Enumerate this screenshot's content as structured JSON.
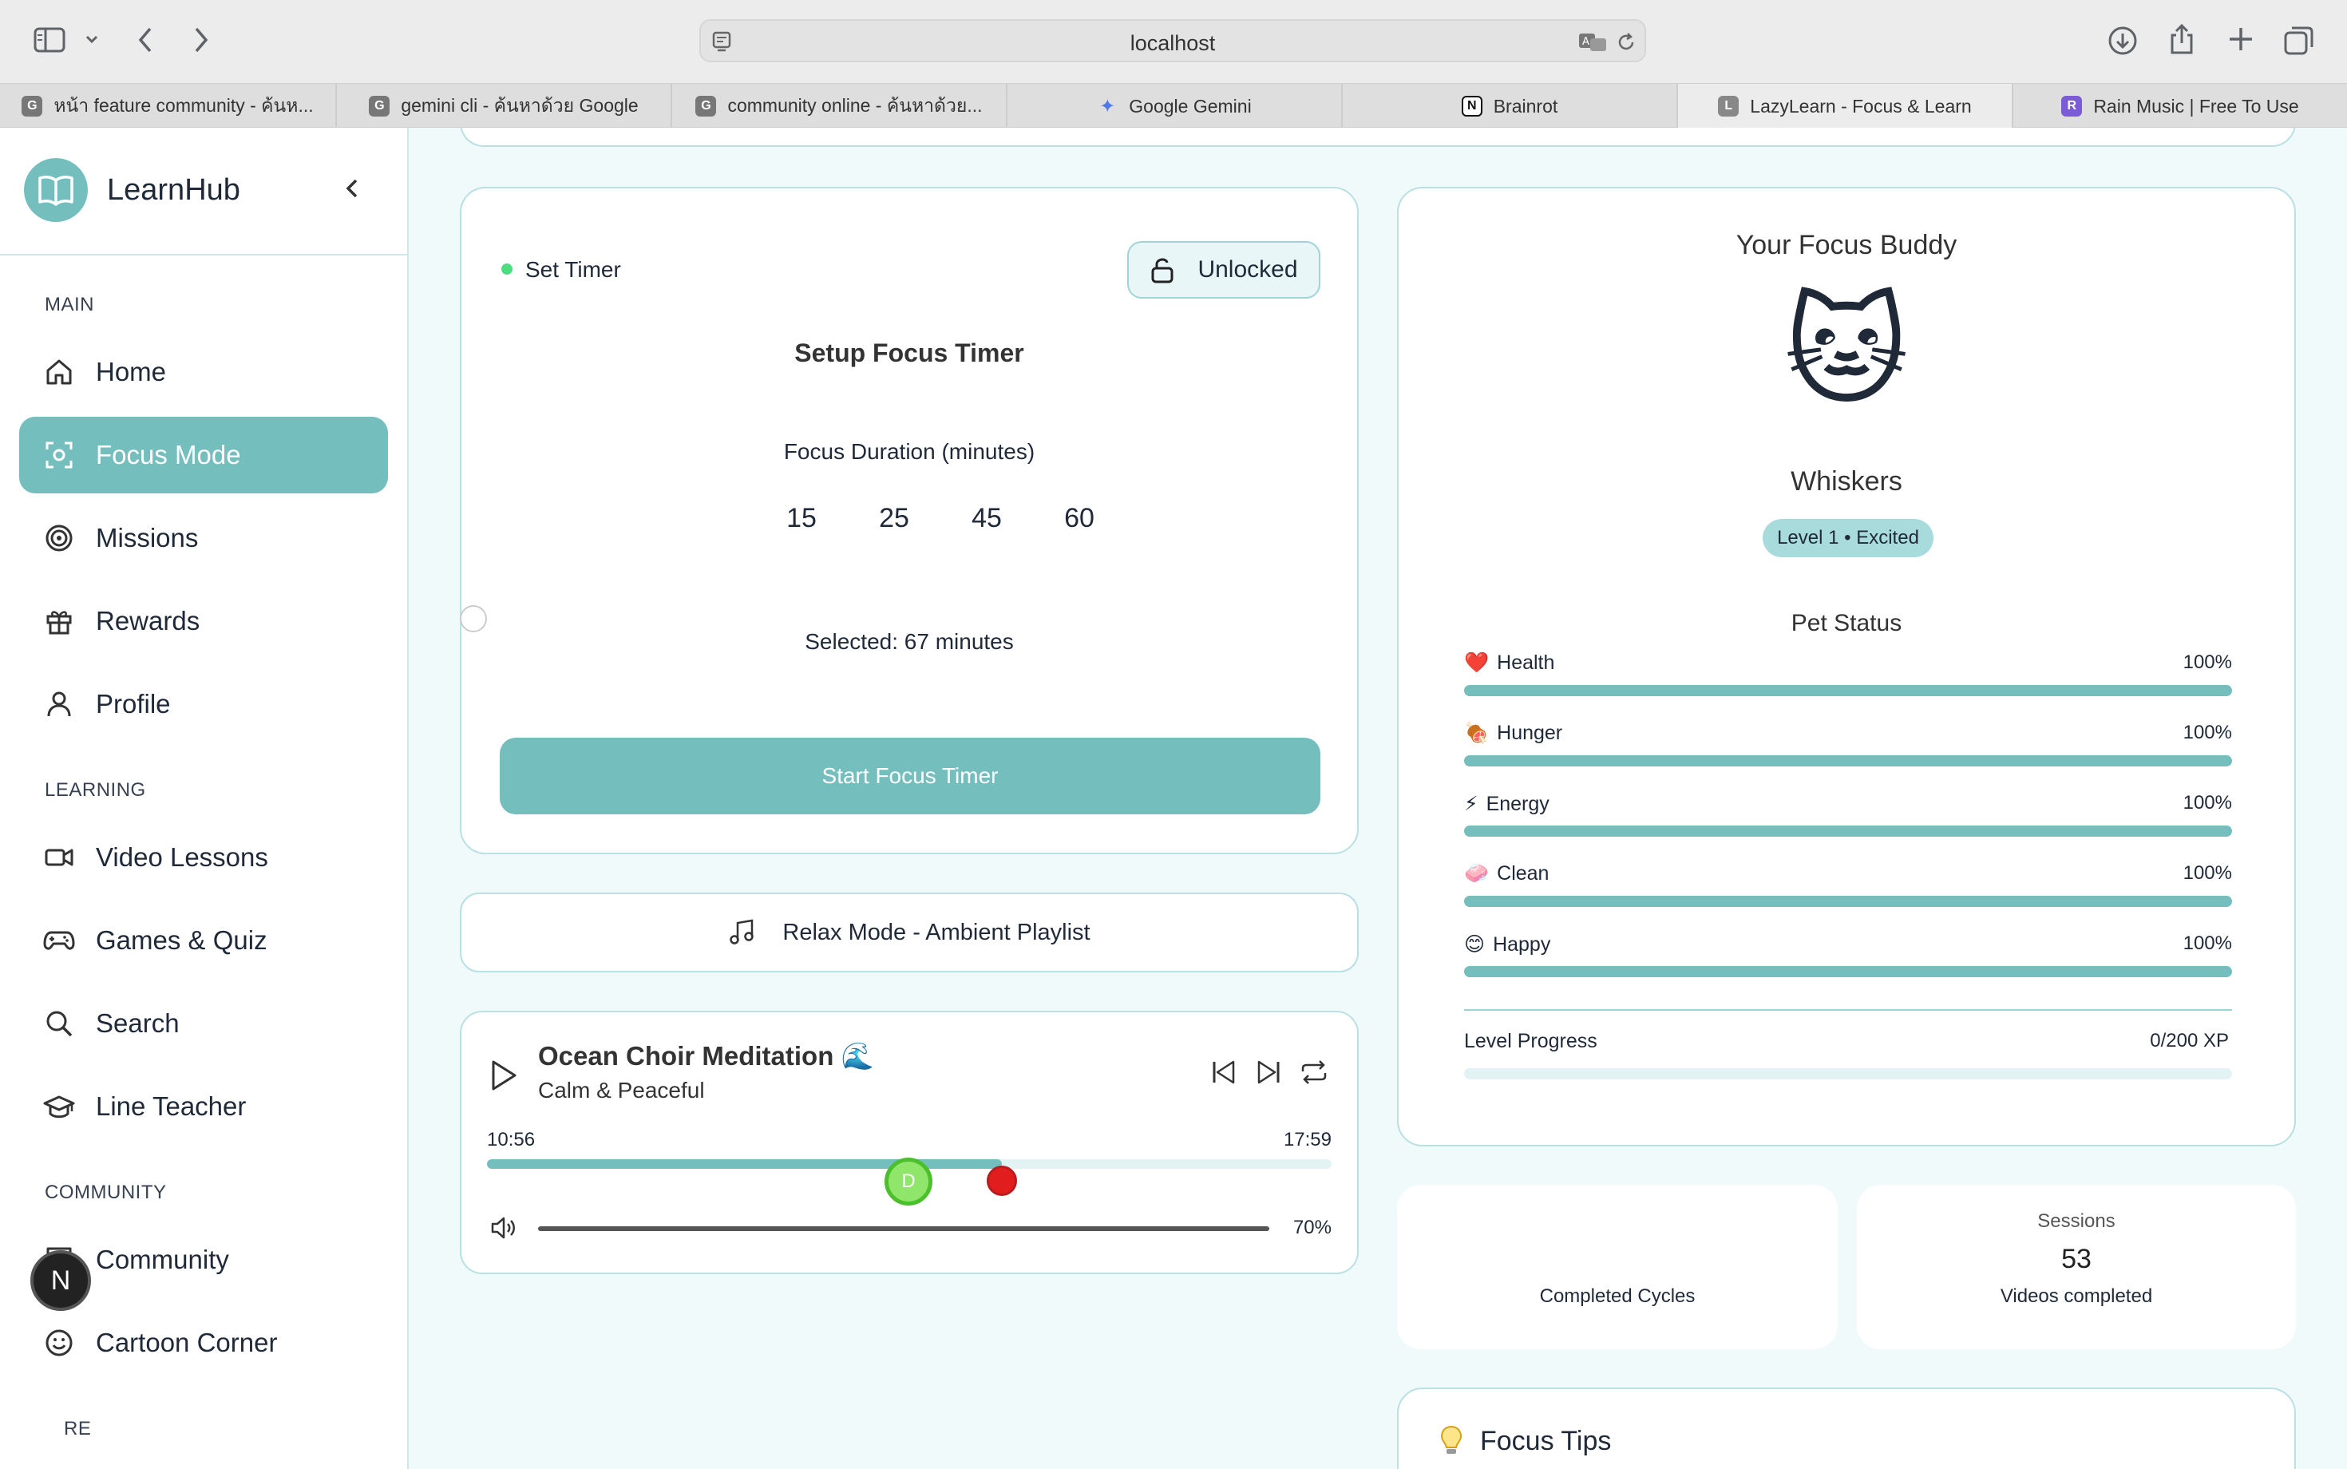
{
  "browser": {
    "url": "localhost",
    "tabs": [
      {
        "label": "หน้า feature community - ค้นห...",
        "favicon": "G"
      },
      {
        "label": "gemini cli - ค้นหาด้วย Google",
        "favicon": "G"
      },
      {
        "label": "community online - ค้นหาด้วย...",
        "favicon": "G"
      },
      {
        "label": "Google Gemini",
        "favicon": "✦"
      },
      {
        "label": "Brainrot",
        "favicon": "N"
      },
      {
        "label": "LazyLearn - Focus & Learn",
        "favicon": "L"
      },
      {
        "label": "Rain Music | Free To Use",
        "favicon": "R"
      }
    ]
  },
  "sidebar": {
    "brand": "LearnHub",
    "sections": {
      "main": "MAIN",
      "learning": "LEARNING",
      "community": "COMMUNITY",
      "more_partial": "RE"
    },
    "items": {
      "home": "Home",
      "focus": "Focus Mode",
      "missions": "Missions",
      "rewards": "Rewards",
      "profile": "Profile",
      "video": "Video Lessons",
      "games": "Games & Quiz",
      "search": "Search",
      "line_teacher": "Line Teacher",
      "community": "Community",
      "cartoon": "Cartoon Corner"
    },
    "floating_badge": "N"
  },
  "timer": {
    "status": "Set Timer",
    "lock_label": "Unlocked",
    "title": "Setup Focus Timer",
    "duration_label": "Focus Duration (minutes)",
    "durations": [
      "15",
      "25",
      "45",
      "60"
    ],
    "selected": "Selected: 67 minutes",
    "start_label": "Start Focus Timer"
  },
  "relax": {
    "label": "Relax Mode - Ambient Playlist"
  },
  "player": {
    "title": "Ocean Choir Meditation 🌊",
    "subtitle": "Calm & Peaceful",
    "current_time": "10:56",
    "total_time": "17:59",
    "progress": 0.61,
    "volume": "70%",
    "cursor_badge": "D"
  },
  "pet": {
    "heading": "Your Focus Buddy",
    "emoji": "🐱",
    "name": "Whiskers",
    "level": "Level 1 • Excited",
    "status_heading": "Pet Status",
    "stats": [
      {
        "emoji": "❤️",
        "name": "Health",
        "value": "100%"
      },
      {
        "emoji": "🍖",
        "name": "Hunger",
        "value": "100%"
      },
      {
        "emoji": "⚡",
        "name": "Energy",
        "value": "100%"
      },
      {
        "emoji": "🧼",
        "name": "Clean",
        "value": "100%"
      },
      {
        "emoji": "😊",
        "name": "Happy",
        "value": "100%"
      }
    ],
    "level_progress_label": "Level Progress",
    "level_progress_value": "0/200 XP"
  },
  "stats_cards": {
    "cycles_label": "Completed Cycles",
    "sessions_title": "Sessions",
    "sessions_value": "53",
    "sessions_label": "Videos completed"
  },
  "tips": {
    "title": "Focus Tips"
  },
  "colors": {
    "accent": "#74bfbd",
    "background": "#f0fafb",
    "border": "#b9e0e2"
  }
}
